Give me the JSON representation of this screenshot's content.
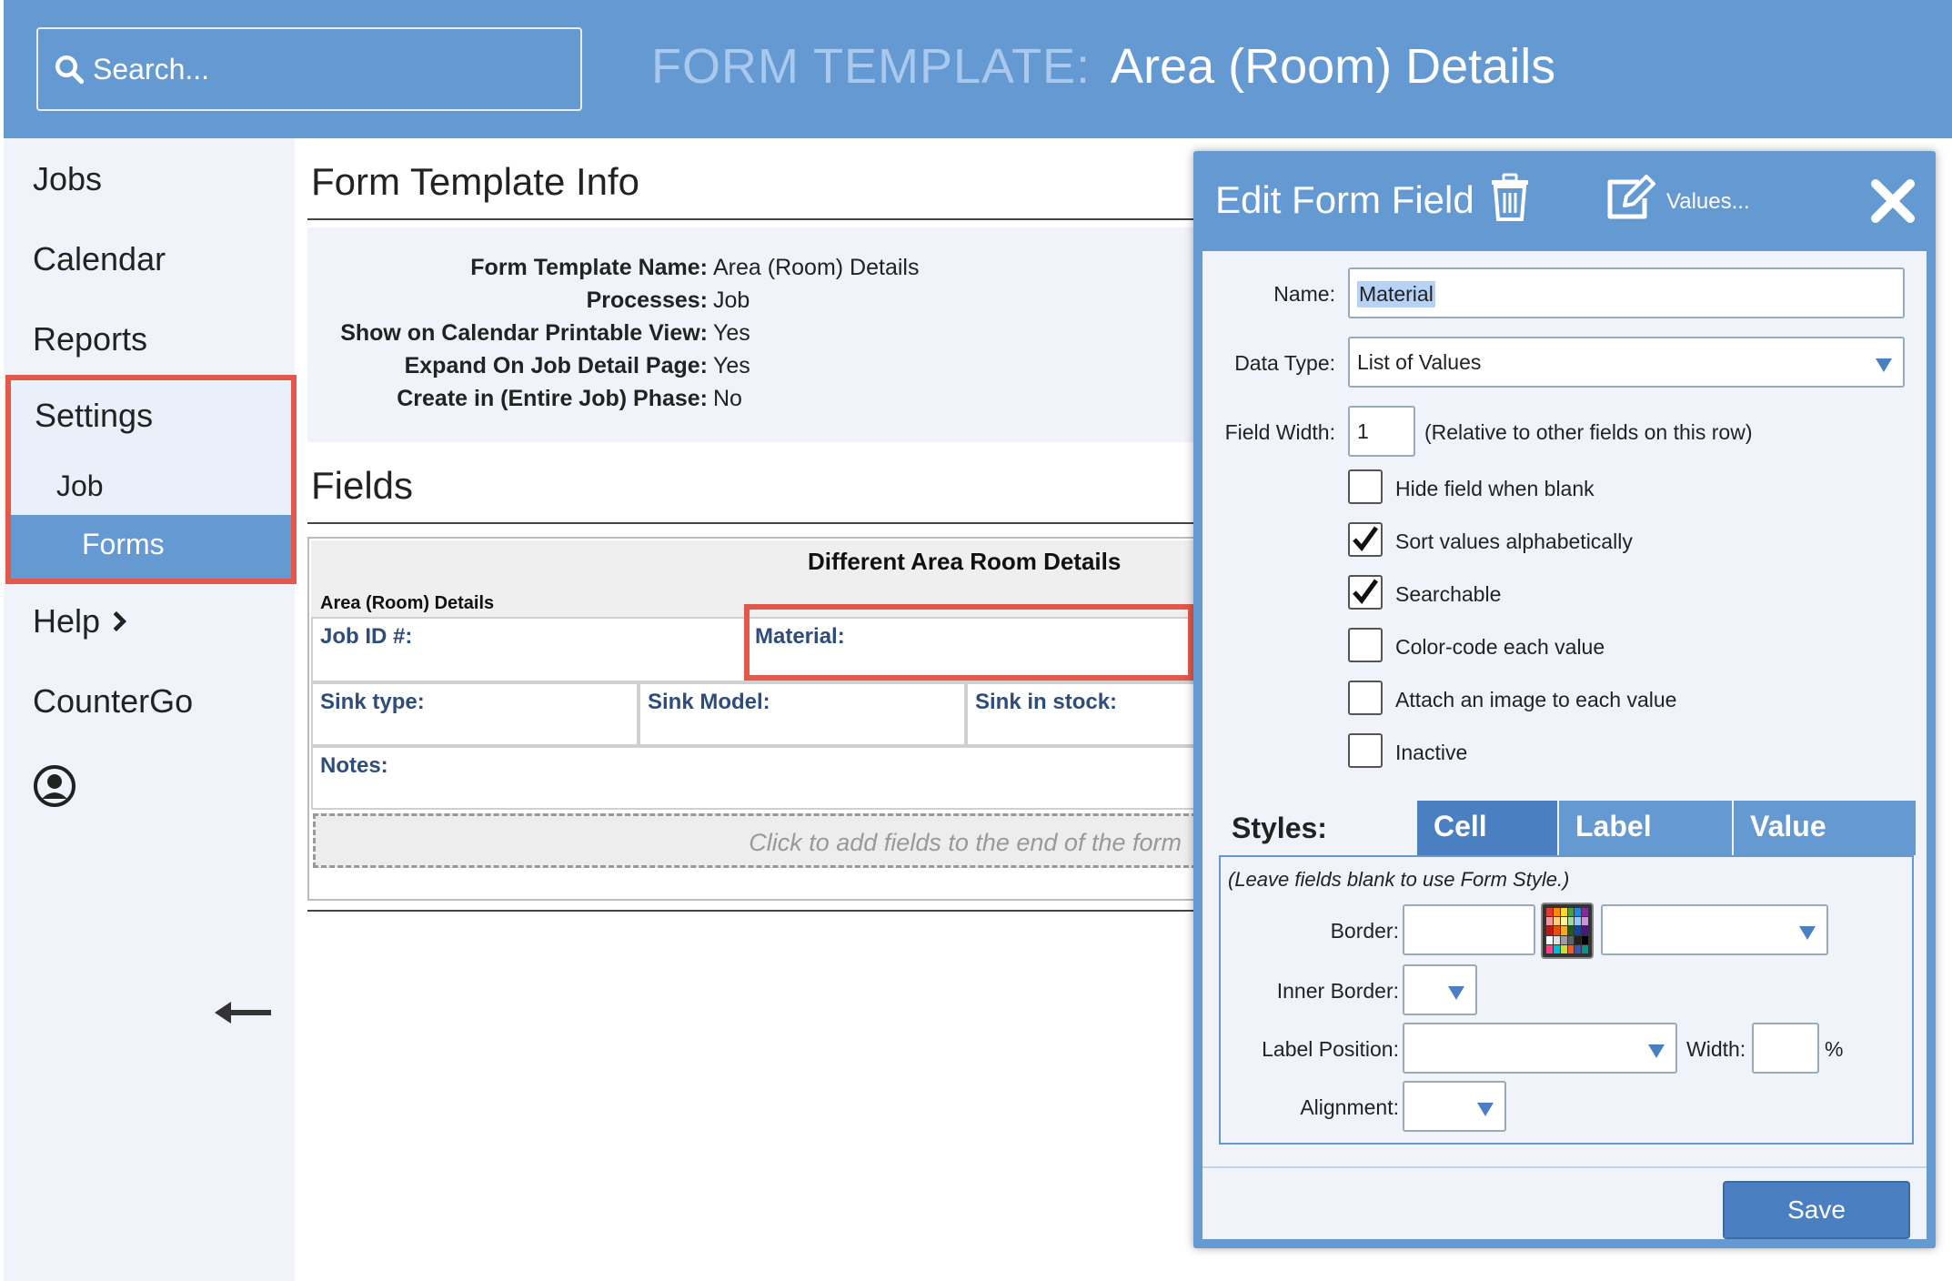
{
  "header": {
    "search_placeholder": "Search...",
    "title_prefix": "FORM TEMPLATE:",
    "title_name": "Area (Room) Details"
  },
  "sidebar": {
    "items": [
      "Jobs",
      "Calendar",
      "Reports"
    ],
    "settings": "Settings",
    "job": "Job",
    "forms": "Forms",
    "help": "Help",
    "countergo": "CounterGo"
  },
  "info": {
    "section_title": "Form Template Info",
    "rows": [
      {
        "k": "Form Template Name:",
        "v": "Area (Room) Details"
      },
      {
        "k": "Processes:",
        "v": "Job"
      },
      {
        "k": "Show on Calendar Printable View:",
        "v": "Yes"
      },
      {
        "k": "Expand On Job Detail Page:",
        "v": "Yes"
      },
      {
        "k": "Create in (Entire Job) Phase:",
        "v": "No"
      }
    ]
  },
  "fields": {
    "section_title": "Fields",
    "form_title": "Different Area Room Details",
    "form_subtitle": "Area (Room) Details",
    "cells": [
      "Job ID #:",
      "Material:",
      "Sink type:",
      "Sink Model:",
      "Sink in stock:",
      "Notes:"
    ],
    "add_hint": "Click to add fields to the end of the form"
  },
  "dialog": {
    "title": "Edit Form Field",
    "values_link": "Values...",
    "name_label": "Name:",
    "name_value": "Material",
    "data_type_label": "Data Type:",
    "data_type_value": "List of Values",
    "field_width_label": "Field Width:",
    "field_width_value": "1",
    "field_width_hint": "(Relative to other fields on this row)",
    "checkboxes": [
      {
        "label": "Hide field when blank",
        "checked": false
      },
      {
        "label": "Sort values alphabetically",
        "checked": true
      },
      {
        "label": "Searchable",
        "checked": true
      },
      {
        "label": "Color-code each value",
        "checked": false
      },
      {
        "label": "Attach an image to each value",
        "checked": false
      },
      {
        "label": "Inactive",
        "checked": false
      }
    ],
    "styles_label": "Styles:",
    "tabs": [
      "Cell",
      "Label",
      "Value"
    ],
    "styles_note": "(Leave fields blank to use Form Style.)",
    "border_label": "Border:",
    "inner_border_label": "Inner Border:",
    "label_position_label": "Label Position:",
    "width_label": "Width:",
    "percent": "%",
    "alignment_label": "Alignment:",
    "save_label": "Save"
  },
  "colors": {
    "header_blue": "#6499d2",
    "highlight_red": "#e4584a",
    "tab_active": "#4a7fc1",
    "label_blue": "#2f4d7a"
  }
}
